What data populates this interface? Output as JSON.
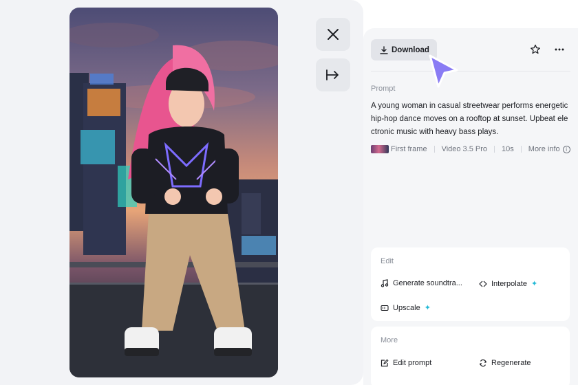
{
  "video": {
    "description_icon": "video-preview"
  },
  "side_buttons": {
    "close_icon": "close-icon",
    "collapse_icon": "collapse-panel-icon"
  },
  "toolbar": {
    "download_label": "Download"
  },
  "prompt": {
    "label": "Prompt",
    "text": "A young woman in casual streetwear performs energetic hip-hop dance moves on a rooftop at sunset. Upbeat electronic music with heavy bass plays."
  },
  "meta": {
    "first_frame": "First frame",
    "model": "Video 3.5 Pro",
    "duration": "10s",
    "more_info": "More info"
  },
  "edit": {
    "title": "Edit",
    "generate_soundtrack": "Generate soundtra...",
    "interpolate": "Interpolate",
    "upscale": "Upscale"
  },
  "more": {
    "title": "More",
    "edit_prompt": "Edit prompt",
    "regenerate": "Regenerate"
  },
  "colors": {
    "accent_cursor": "#8a7cf4",
    "spark": "#22b9d6"
  }
}
